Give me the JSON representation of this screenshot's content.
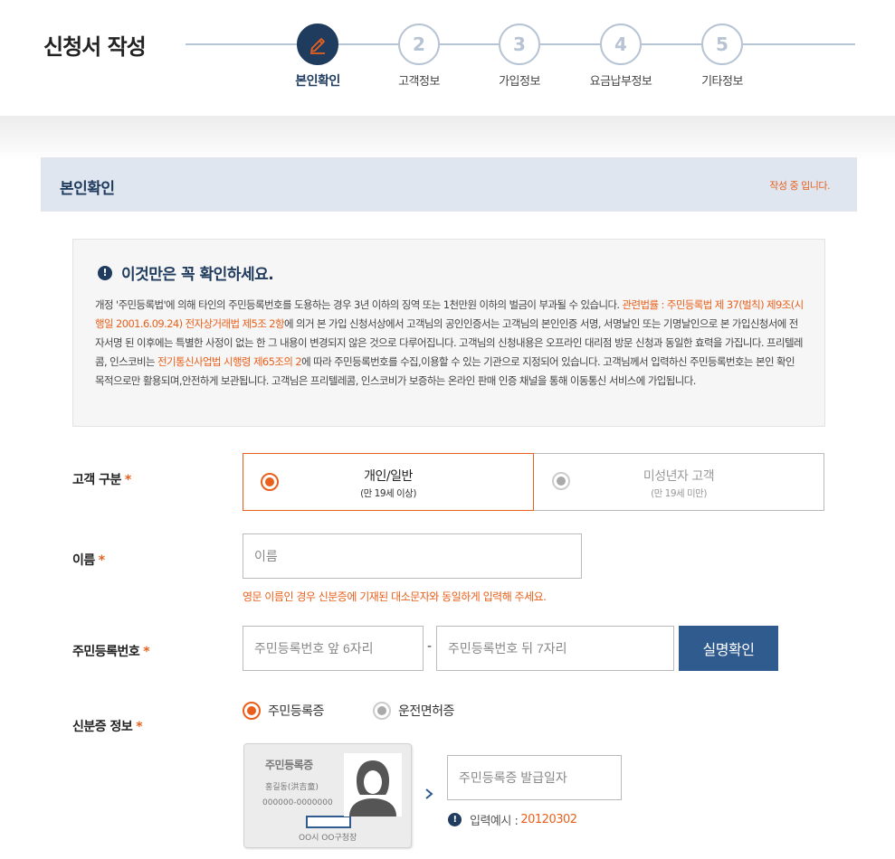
{
  "header": {
    "title": "신청서 작성",
    "steps": [
      {
        "label": "본인확인",
        "icon": "pencil-icon",
        "active": true
      },
      {
        "number": "2",
        "label": "고객정보"
      },
      {
        "number": "3",
        "label": "가입정보"
      },
      {
        "number": "4",
        "label": "요금납부정보"
      },
      {
        "number": "5",
        "label": "기타정보"
      }
    ]
  },
  "section": {
    "title": "본인확인",
    "status": "작성 중 입니다."
  },
  "notice": {
    "title": "이것만은 꼭 확인하세요.",
    "body_1": "개정 '주민등록법'에 의해 타인의 주민등록번호를 도용하는 경우 3년 이하의 징역 또는 1천만원 이하의 벌금이 부과될 수 있습니다. ",
    "body_hl_1": "관련법률 : 주민등록법 제 37(벌칙) 제9조(시행일 2001.6.09.24) 전자상거래법 제5조 2항",
    "body_2": "에 의거 본 가입 신청서상에서 고객님의 공인인증서는 고객님의 본인인증 서명, 서명날인 또는 기명날인으로 본 가입신청서에 전자서명 된 이후에는 특별한 사정이 없는 한 그 내용이 변경되지 않은 것으로 다루어집니다. 고객님의 신청내용은 오프라인 대리점 방문 신청과 동일한 효력을 가집니다. 프리텔레콤, 인스코비는 ",
    "body_hl_2": "전기통신사업법 시행령 제65조의 2",
    "body_3": "에 따라 주민등록번호를 수집,이용할 수 있는 기관으로 지정되어 있습니다. 고객님께서 입력하신 주민등록번호는 본인 확인 목적으로만 활용되며,안전하게 보관됩니다. 고객님은 프리텔레콤, 인스코비가 보증하는 온라인 판매 인증 채널을 통해 이동통신 서비스에 가입됩니다."
  },
  "form": {
    "required_mark": "*",
    "customer_type": {
      "label": "고객 구분",
      "options": [
        {
          "main": "개인/일반",
          "sub": "(만 19세 이상)",
          "selected": true
        },
        {
          "main": "미성년자 고객",
          "sub": "(만 19세 미만)",
          "selected": false
        }
      ]
    },
    "name": {
      "label": "이름",
      "placeholder": "이름",
      "hint": "영문 이름인 경우 신분증에 기재된 대소문자와 동일하게 입력해 주세요."
    },
    "rrn": {
      "label": "주민등록번호",
      "front_placeholder": "주민등록번호 앞 6자리",
      "separator": "-",
      "back_placeholder": "주민등록번호 뒤 7자리",
      "verify_button": "실명확인"
    },
    "id_info": {
      "label": "신분증 정보",
      "options": [
        {
          "label": "주민등록증",
          "selected": true
        },
        {
          "label": "운전면허증",
          "selected": false
        }
      ],
      "card": {
        "title": "주민등록증",
        "name": "홍길동(洪吉童)",
        "number": "000000-0000000",
        "issuer": "OO시 OO구청장"
      },
      "date_placeholder": "주민등록증 발급일자",
      "example_label": "입력예시 :",
      "example_value": "20120302"
    }
  },
  "colors": {
    "accent": "#e8601c",
    "navy": "#1f3b5e",
    "button": "#2f5b8f"
  }
}
